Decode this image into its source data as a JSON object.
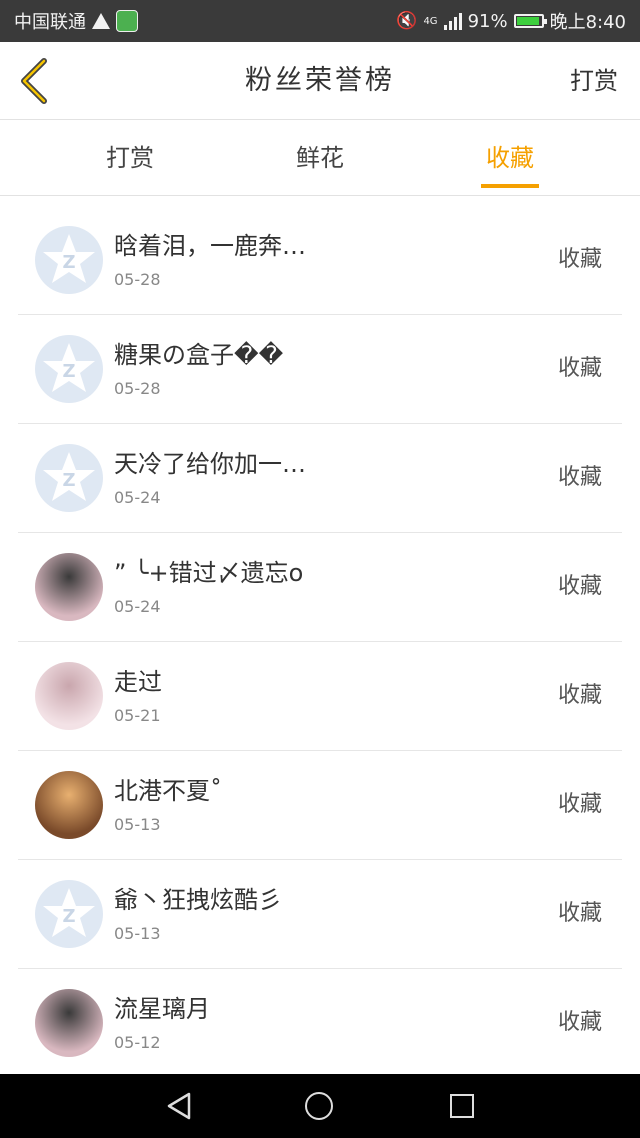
{
  "status_bar": {
    "carrier": "中国联通",
    "network": "4G",
    "battery": "91%",
    "time": "晚上8:40",
    "battery_level": 0.91
  },
  "header": {
    "title": "粉丝荣誉榜",
    "reward_button": "打赏"
  },
  "tabs": [
    {
      "label": "打赏",
      "active": false
    },
    {
      "label": "鲜花",
      "active": false
    },
    {
      "label": "收藏",
      "active": true
    }
  ],
  "rows": [
    {
      "name": "晗着泪，一鹿奔…",
      "date": "05-28",
      "action": "收藏",
      "avatar": "default-avatar"
    },
    {
      "name": "糖果の盒子��",
      "date": "05-28",
      "action": "收藏",
      "avatar": "default-avatar"
    },
    {
      "name": "天冷了给你加一…",
      "date": "05-24",
      "action": "收藏",
      "avatar": "default-avatar"
    },
    {
      "name": "” ╰+错过〆遗忘o",
      "date": "05-24",
      "action": "收藏",
      "avatar": "photo-avatar"
    },
    {
      "name": "走过",
      "date": "05-21",
      "action": "收藏",
      "avatar": "photo-avatar"
    },
    {
      "name": "北港不夏˚",
      "date": "05-13",
      "action": "收藏",
      "avatar": "photo-avatar"
    },
    {
      "name": "爺丶狂拽炫酷彡",
      "date": "05-13",
      "action": "收藏",
      "avatar": "default-avatar"
    },
    {
      "name": "流星璃月",
      "date": "05-12",
      "action": "收藏",
      "avatar": "photo-avatar"
    }
  ],
  "colors": {
    "accent": "#f5a000",
    "status_bar": "#3a3a3a",
    "nav_bar": "#000000"
  }
}
